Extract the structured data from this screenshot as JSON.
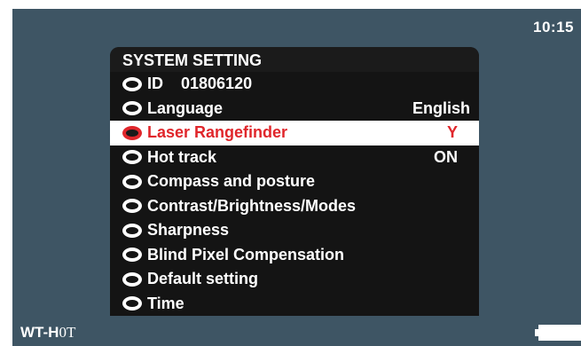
{
  "status": {
    "clock": "10:15",
    "device_name": "WT-H",
    "device_suffix": "0T"
  },
  "menu": {
    "title": "SYSTEM SETTING",
    "items": [
      {
        "label": "ID",
        "value": "01806120",
        "selected": false
      },
      {
        "label": "Language",
        "value": "English",
        "selected": false
      },
      {
        "label": "Laser Rangefinder",
        "value": "Y",
        "selected": true
      },
      {
        "label": "Hot track",
        "value": "ON",
        "selected": false
      },
      {
        "label": "Compass and posture",
        "value": "",
        "selected": false
      },
      {
        "label": "Contrast/Brightness/Modes",
        "value": "",
        "selected": false
      },
      {
        "label": "Sharpness",
        "value": "",
        "selected": false
      },
      {
        "label": "Blind Pixel Compensation",
        "value": "",
        "selected": false
      },
      {
        "label": "Default setting",
        "value": "",
        "selected": false
      },
      {
        "label": "Time",
        "value": "",
        "selected": false
      }
    ]
  },
  "colors": {
    "screen_background": "#3e5564",
    "menu_background": "#141414",
    "highlight_background": "#ffffff",
    "highlight_text": "#e0262b",
    "text": "#ffffff"
  },
  "icons": {
    "radio": "radio-ring-icon",
    "battery": "battery-icon"
  }
}
